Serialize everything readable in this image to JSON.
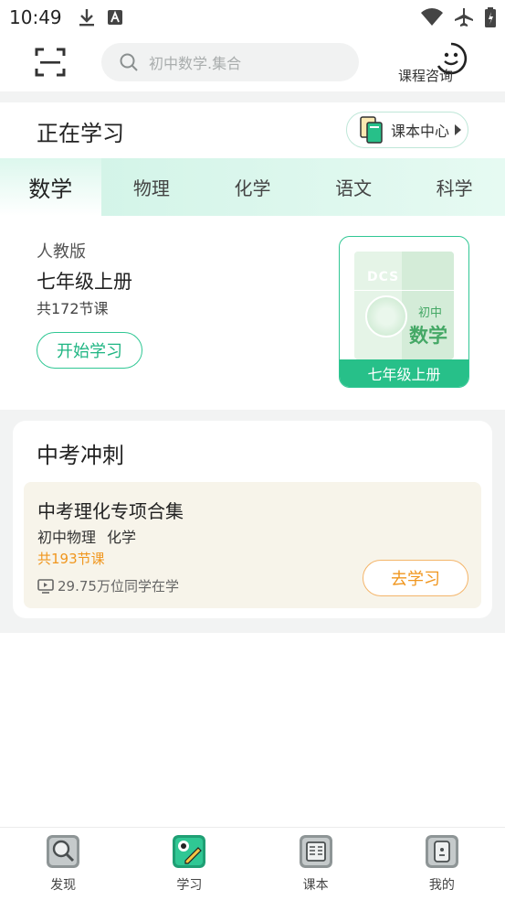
{
  "status_bar": {
    "time": "10:49"
  },
  "header": {
    "search_placeholder": "初中数学.集合",
    "consult_label": "课程咨询"
  },
  "studying": {
    "title": "正在学习",
    "textbook_center_label": "课本中心",
    "tabs": [
      {
        "label": "数学",
        "active": true
      },
      {
        "label": "物理",
        "active": false
      },
      {
        "label": "化学",
        "active": false
      },
      {
        "label": "语文",
        "active": false
      },
      {
        "label": "科学",
        "active": false
      }
    ],
    "edition": "人教版",
    "grade": "七年级上册",
    "lesson_count": "共172节课",
    "start_button": "开始学习",
    "book": {
      "logo": "DCS",
      "level": "初中",
      "subject": "数学",
      "band": "七年级上册"
    }
  },
  "exam_rush": {
    "title": "中考冲刺",
    "course": {
      "name": "中考理化专项合集",
      "subjects": [
        "初中物理",
        "化学"
      ],
      "lessons": "共193节课",
      "learners": "29.75万位同学在学",
      "go_button": "去学习"
    }
  },
  "bottom_nav": [
    {
      "label": "发现",
      "icon": "magnifier-icon"
    },
    {
      "label": "学习",
      "icon": "study-icon"
    },
    {
      "label": "课本",
      "icon": "textbook-icon"
    },
    {
      "label": "我的",
      "icon": "profile-icon"
    }
  ],
  "colors": {
    "accent_green": "#27c089",
    "accent_orange": "#f0961e"
  }
}
